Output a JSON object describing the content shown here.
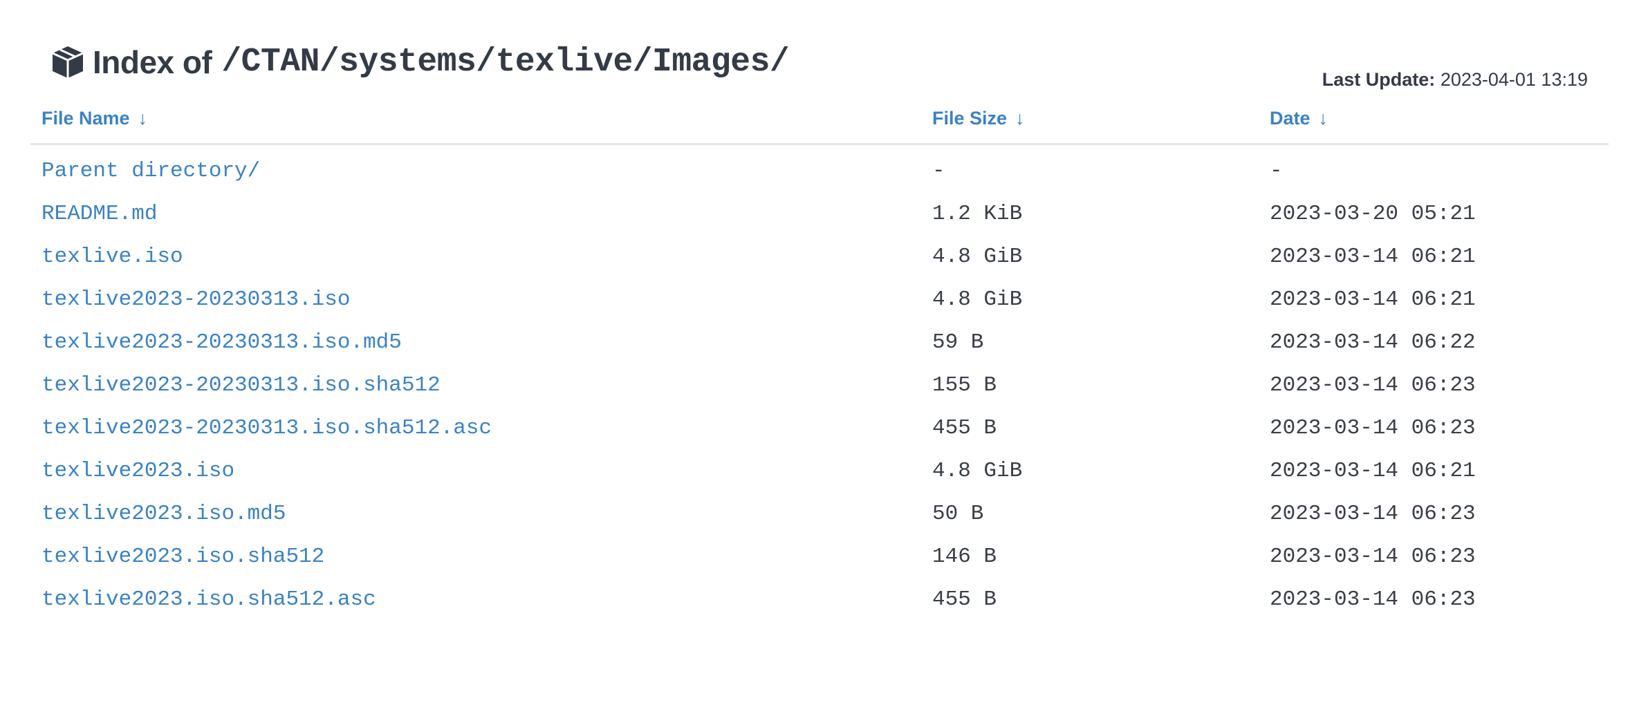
{
  "header": {
    "title_prefix": "Index of",
    "path": "/CTAN/systems/texlive/Images/",
    "last_update_label": "Last Update:",
    "last_update_value": "2023-04-01 13:19",
    "icon": "box-icon"
  },
  "table": {
    "columns": [
      {
        "label": "File Name",
        "sort_arrow": "↓"
      },
      {
        "label": "File Size",
        "sort_arrow": "↓"
      },
      {
        "label": "Date",
        "sort_arrow": "↓"
      }
    ],
    "rows": [
      {
        "name": "Parent directory/",
        "size": "-",
        "date": "-"
      },
      {
        "name": "README.md",
        "size": "1.2 KiB",
        "date": "2023-03-20 05:21"
      },
      {
        "name": "texlive.iso",
        "size": "4.8 GiB",
        "date": "2023-03-14 06:21"
      },
      {
        "name": "texlive2023-20230313.iso",
        "size": "4.8 GiB",
        "date": "2023-03-14 06:21"
      },
      {
        "name": "texlive2023-20230313.iso.md5",
        "size": "59 B",
        "date": "2023-03-14 06:22"
      },
      {
        "name": "texlive2023-20230313.iso.sha512",
        "size": "155 B",
        "date": "2023-03-14 06:23"
      },
      {
        "name": "texlive2023-20230313.iso.sha512.asc",
        "size": "455 B",
        "date": "2023-03-14 06:23"
      },
      {
        "name": "texlive2023.iso",
        "size": "4.8 GiB",
        "date": "2023-03-14 06:21"
      },
      {
        "name": "texlive2023.iso.md5",
        "size": "50 B",
        "date": "2023-03-14 06:23"
      },
      {
        "name": "texlive2023.iso.sha512",
        "size": "146 B",
        "date": "2023-03-14 06:23"
      },
      {
        "name": "texlive2023.iso.sha512.asc",
        "size": "455 B",
        "date": "2023-03-14 06:23"
      }
    ]
  },
  "colors": {
    "link": "#3b82c4",
    "text": "#333b47",
    "divider": "#e4e6e8"
  }
}
